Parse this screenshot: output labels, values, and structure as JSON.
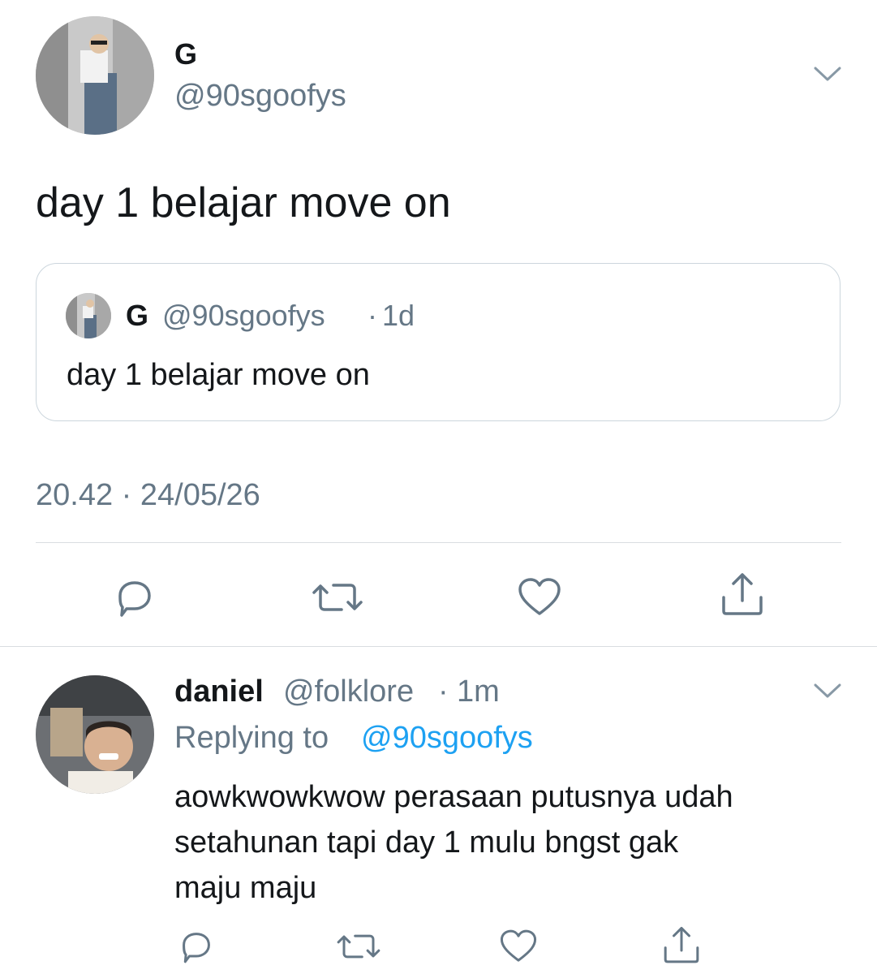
{
  "main_tweet": {
    "display_name": "G",
    "handle": "@90sgoofys",
    "text": "day 1 belajar move on",
    "timestamp": "20.42 · 24/05/26",
    "quoted": {
      "display_name": "G",
      "handle": "@90sgoofys",
      "separator": "·",
      "age": "1d",
      "text": "day 1 belajar move on"
    },
    "actions": [
      "reply-icon",
      "retweet-icon",
      "like-icon",
      "share-icon"
    ]
  },
  "reply_tweet": {
    "display_name": "daniel",
    "handle": "@folklore",
    "separator": "·",
    "age": "1m",
    "replying_prefix": "Replying to",
    "replying_handle": "@90sgoofys",
    "text_lines": [
      "aowkwowkwow perasaan putusnya udah",
      "setahunan tapi day 1 mulu bngst gak",
      "maju maju"
    ],
    "actions": [
      "reply-icon",
      "retweet-icon",
      "like-icon",
      "share-icon"
    ]
  },
  "colors": {
    "text": "#14171a",
    "muted": "#657786",
    "link": "#1da1f2",
    "border": "#d9dde1"
  }
}
